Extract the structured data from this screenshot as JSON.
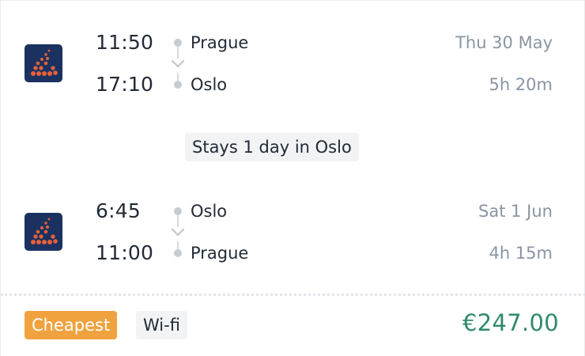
{
  "outbound": {
    "depart_time": "11:50",
    "arrive_time": "17:10",
    "origin": "Prague",
    "destination": "Oslo",
    "date": "Thu 30 May",
    "duration": "5h 20m",
    "airline_logo_icon": "airline-logo-icon"
  },
  "stay": {
    "label": "Stays 1 day in Oslo"
  },
  "return": {
    "depart_time": "6:45",
    "arrive_time": "11:00",
    "origin": "Oslo",
    "destination": "Prague",
    "date": "Sat 1 Jun",
    "duration": "4h 15m",
    "airline_logo_icon": "airline-logo-icon"
  },
  "tags": {
    "cheapest": "Cheapest",
    "wifi": "Wi-fi"
  },
  "price": "€247.00",
  "colors": {
    "price": "#2f8a6c",
    "cheapest_badge": "#f0a23f",
    "logo_bg": "#1b3260",
    "logo_dots": "#e8603a"
  }
}
